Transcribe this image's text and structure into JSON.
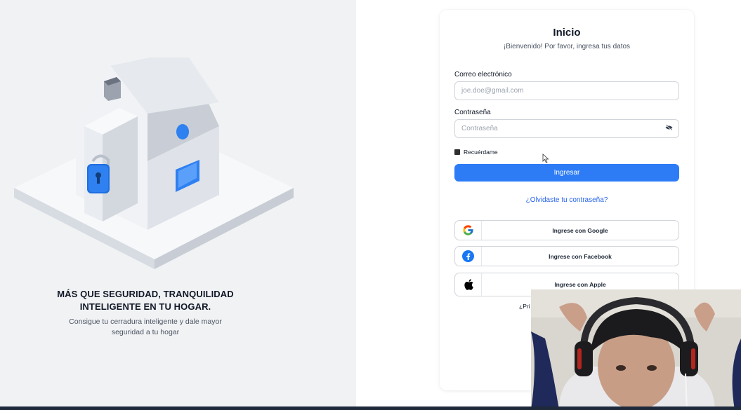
{
  "hero": {
    "title_line1": "MÁS QUE SEGURIDAD, TRANQUILIDAD",
    "title_line2": "INTELIGENTE EN TU HOGAR.",
    "sub_line1": "Consigue tu cerradura inteligente y dale mayor",
    "sub_line2": "seguridad a tu hogar"
  },
  "login": {
    "title": "Inicio",
    "subtitle": "¡Bienvenido! Por favor, ingresa tus datos",
    "email_label": "Correo electrónico",
    "email_placeholder": "joe.doe@gmail.com",
    "password_label": "Contraseña",
    "password_placeholder": "Contraseña",
    "remember_label": "Recuérdame",
    "submit_label": "Ingresar",
    "forgot_label": "¿Olvidaste tu contraseña?",
    "google_label": "Ingrese con Google",
    "facebook_label": "Ingrese con Facebook",
    "apple_label": "Ingrese con Apple",
    "register_partial": "¿Pri"
  },
  "colors": {
    "primary": "#2d7cf6",
    "left_bg": "#f1f2f4",
    "link": "#2563eb"
  },
  "icons": [
    "lock-icon",
    "eye-slash-icon",
    "google-icon",
    "facebook-icon",
    "apple-icon",
    "mouse-cursor-icon"
  ]
}
